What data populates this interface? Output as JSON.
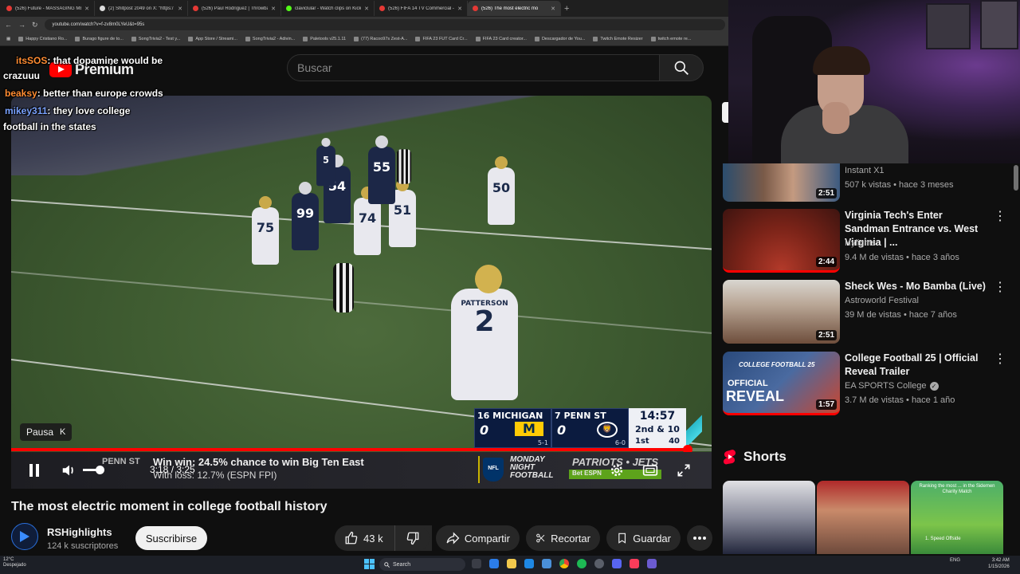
{
  "browser": {
    "tabs": [
      {
        "title": "(526) Future - MASSAGING ME",
        "icon": "youtube-icon"
      },
      {
        "title": "(2) Shitpost 2049 on X: \"https:/",
        "icon": "x-icon"
      },
      {
        "title": "(526) Paul Rodriguez | Throwba",
        "icon": "youtube-icon"
      },
      {
        "title": "claviclular - Watch clips on Kick",
        "icon": "kick-icon"
      },
      {
        "title": "(526) FIFA 14 TV Commercial -",
        "icon": "youtube-icon"
      },
      {
        "title": "(526) The most electric mo",
        "icon": "youtube-icon",
        "active": true
      }
    ],
    "url": "youtube.com/watch?v=f-zv8m0LYeU&t=95s",
    "bookmarks": [
      "Happy Cristiano Ro...",
      "Burago figure de to...",
      "SongTrivia2 - Test y...",
      "App Store / Streami...",
      "SongTrivia2 - Adivin...",
      "Paletools v25.1.11",
      "(77) Racoo97s Zest-A...",
      "FIFA 23 FUT Card Cr...",
      "FIFA 23 Card creator...",
      "Descargador de You...",
      "Twitch Emote Resizer",
      "twitch emote re..."
    ]
  },
  "youtube": {
    "logo_text": "Premium",
    "search_placeholder": "Buscar"
  },
  "chat": [
    {
      "user": "itsSOS",
      "text": ": that dopamine would be",
      "cont": "crazuuu"
    },
    {
      "user": "beaksy",
      "text": ": better than europe crowds"
    },
    {
      "user": "mikey311",
      "text": ": they love college",
      "cont": "football in the states"
    }
  ],
  "video": {
    "main_player_name": "PATTERSON",
    "main_player_number": "2",
    "players": [
      {
        "num": "75",
        "dark": false
      },
      {
        "num": "99",
        "dark": true
      },
      {
        "num": "54",
        "dark": true
      },
      {
        "num": "74",
        "dark": false
      },
      {
        "num": "51",
        "dark": false
      },
      {
        "num": "55",
        "dark": true
      },
      {
        "num": "50",
        "dark": false
      },
      {
        "num": "5",
        "dark": true
      }
    ],
    "scorebug": {
      "team1_name": "16 MICHIGAN",
      "team1_score": "0",
      "team1_logo": "M",
      "team1_record": "5-1",
      "team2_name": "7 PENN ST",
      "team2_score": "0",
      "team2_record": "6-0",
      "clock": "14:57",
      "down": "2nd & 10",
      "quarter": "1st",
      "playclock": "40"
    },
    "ticker": {
      "team": "PENN ST",
      "win_line": "Win win: 24.5% chance to win Big Ten East",
      "loss_line": "With loss: 12.7% (ESPN FPI)",
      "mnf_line1": "MONDAY",
      "mnf_line2": "NIGHT",
      "mnf_line3": "FOOTBALL",
      "nfl": "NFL",
      "matchup": "PATRIOTS • JETS",
      "matchup_sub": "Bet ESPN"
    },
    "pause_tooltip": "Pausa",
    "pause_key": "K",
    "time_display": "3:18 / 3:25",
    "progress": 0.966,
    "volume": 0.7
  },
  "video_info": {
    "title": "The most electric moment in college football history",
    "channel": "RSHighlights",
    "subscribers": "124 k suscriptores",
    "subscribe_label": "Suscribirse",
    "likes": "43 k",
    "share_label": "Compartir",
    "clip_label": "Recortar",
    "save_label": "Guardar"
  },
  "sidebar": {
    "recommendations": [
      {
        "title": "",
        "channel": "Instant X1",
        "meta": "507 k vistas • hace 3 meses",
        "duration": "2:51",
        "verified": false
      },
      {
        "title": "Virginia Tech's Enter Sandman Entrance vs. West Virginia | ...",
        "channel": "Hylights",
        "meta": "9.4 M de vistas • hace 3 años",
        "duration": "2:44",
        "verified": false
      },
      {
        "title": "Sheck Wes - Mo Bamba (Live)",
        "channel": "Astroworld Festival",
        "meta": "39 M de vistas • hace 7 años",
        "duration": "2:51",
        "verified": false
      },
      {
        "title": "College Football 25 | Official Reveal Trailer",
        "channel": "EA SPORTS College",
        "meta": "3.7 M de vistas • hace 1 año",
        "duration": "1:57",
        "verified": true
      }
    ],
    "shorts_label": "Shorts"
  },
  "thumb_text": {
    "cfb_title": "COLLEGE FOOTBALL 25",
    "cfb_official": "OFFICIAL",
    "cfb_reveal": "REVEAL",
    "short3": "Ranking the most ... in the Sidemen Charity Match",
    "short3_item": "1. Speed Offside"
  },
  "taskbar": {
    "weather_temp": "12°C",
    "weather_desc": "Despejado",
    "search_label": "Search",
    "lang": "ENG",
    "time": "3:42 AM",
    "date": "1/15/2026"
  },
  "colors": {
    "yt_red": "#ff0000",
    "background": "#0f0f0f",
    "michigan_maize": "#ffcb05",
    "navy": "#0b1b3f"
  }
}
